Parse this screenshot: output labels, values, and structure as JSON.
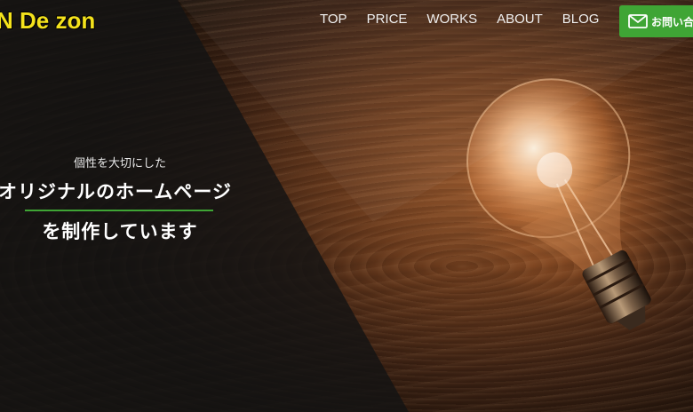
{
  "header": {
    "logo_text": "De zon",
    "nav": [
      "TOP",
      "PRICE",
      "WORKS",
      "ABOUT",
      "BLOG"
    ],
    "contact_label": "お問い合",
    "contact_icon": "mail-icon"
  },
  "hero": {
    "tagline_small": "個性を大切にした",
    "tagline_line1": "オリジナルのホームページ",
    "tagline_line2": "を制作しています",
    "accent_color": "#3fa535",
    "logo_color": "#f4e21c"
  }
}
